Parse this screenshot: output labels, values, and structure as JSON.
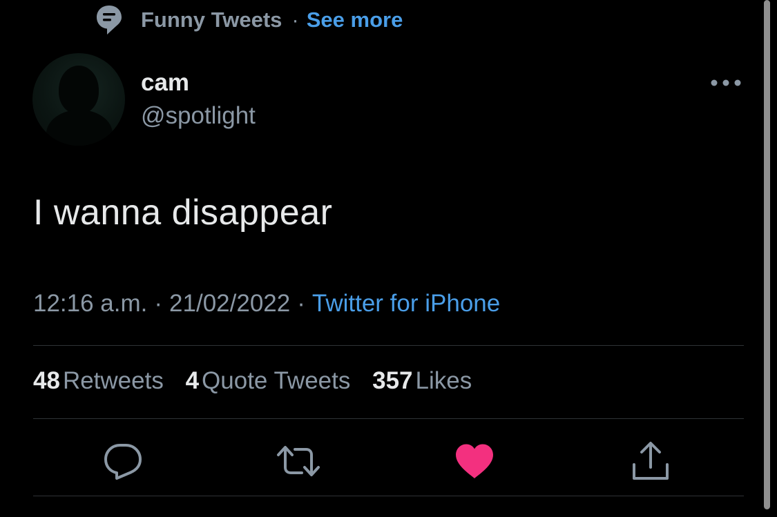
{
  "context": {
    "topic_icon": "topic-icon",
    "name": "Funny Tweets",
    "separator": "·",
    "see_more": "See more"
  },
  "author": {
    "display_name": "cam",
    "handle": "@spotlight",
    "more_icon": "more-horizontal-icon"
  },
  "tweet": {
    "text": "I wanna disappear"
  },
  "meta": {
    "time": "12:16 a.m.",
    "separator": "·",
    "date": "21/02/2022",
    "source": "Twitter for iPhone"
  },
  "stats": {
    "retweets_count": "48",
    "retweets_label": "Retweets",
    "quotes_count": "4",
    "quotes_label": "Quote Tweets",
    "likes_count": "357",
    "likes_label": "Likes"
  },
  "actions": {
    "reply_icon": "reply-icon",
    "retweet_icon": "retweet-icon",
    "like_icon": "heart-icon",
    "share_icon": "share-icon"
  },
  "colors": {
    "background": "#000000",
    "text_primary": "#e7e9ea",
    "text_secondary": "#8b98a5",
    "link": "#4a9ee8",
    "like": "#f3307f",
    "divider": "#2f3336"
  }
}
